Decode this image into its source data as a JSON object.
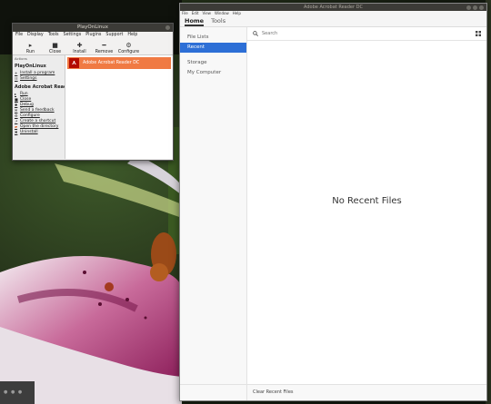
{
  "playonlinux": {
    "title": "PlayOnLinux",
    "menu": [
      "File",
      "Display",
      "Tools",
      "Settings",
      "Plugins",
      "Support",
      "Help"
    ],
    "toolbar": [
      {
        "label": "Run",
        "icon": "play-icon"
      },
      {
        "label": "Close",
        "icon": "stop-icon"
      },
      {
        "label": "Install",
        "icon": "plus-icon"
      },
      {
        "label": "Remove",
        "icon": "minus-icon"
      },
      {
        "label": "Configure",
        "icon": "gear-icon"
      }
    ],
    "sidebar": {
      "header": "Actions",
      "section1": "PlayOnLinux",
      "section1_actions": [
        "Install a program",
        "Settings"
      ],
      "section2": "Adobe Acrobat Reader",
      "section2_actions": [
        "Run",
        "Close",
        "Debug",
        "Send a feedback",
        "Configure",
        "Create a shortcut",
        "Open the directory",
        "Uninstall"
      ]
    },
    "list": [
      {
        "name": "Adobe Acrobat Reader DC",
        "selected": true
      }
    ]
  },
  "acrobat": {
    "title": "Adobe Acrobat Reader DC",
    "menu": [
      "File",
      "Edit",
      "View",
      "Window",
      "Help"
    ],
    "tabs": [
      {
        "label": "Home",
        "active": true
      },
      {
        "label": "Tools",
        "active": false
      }
    ],
    "nav": {
      "file_lists": "File Lists",
      "recent": "Recent",
      "storage": "Storage",
      "my_computer": "My Computer"
    },
    "search_placeholder": "Search",
    "empty_message": "No Recent Files",
    "footer_label": "Clear Recent Files",
    "selection_color": "#2d6fd6"
  },
  "colors": {
    "pol_selected": "#f07a43",
    "title_bar": "#3c3b37"
  }
}
